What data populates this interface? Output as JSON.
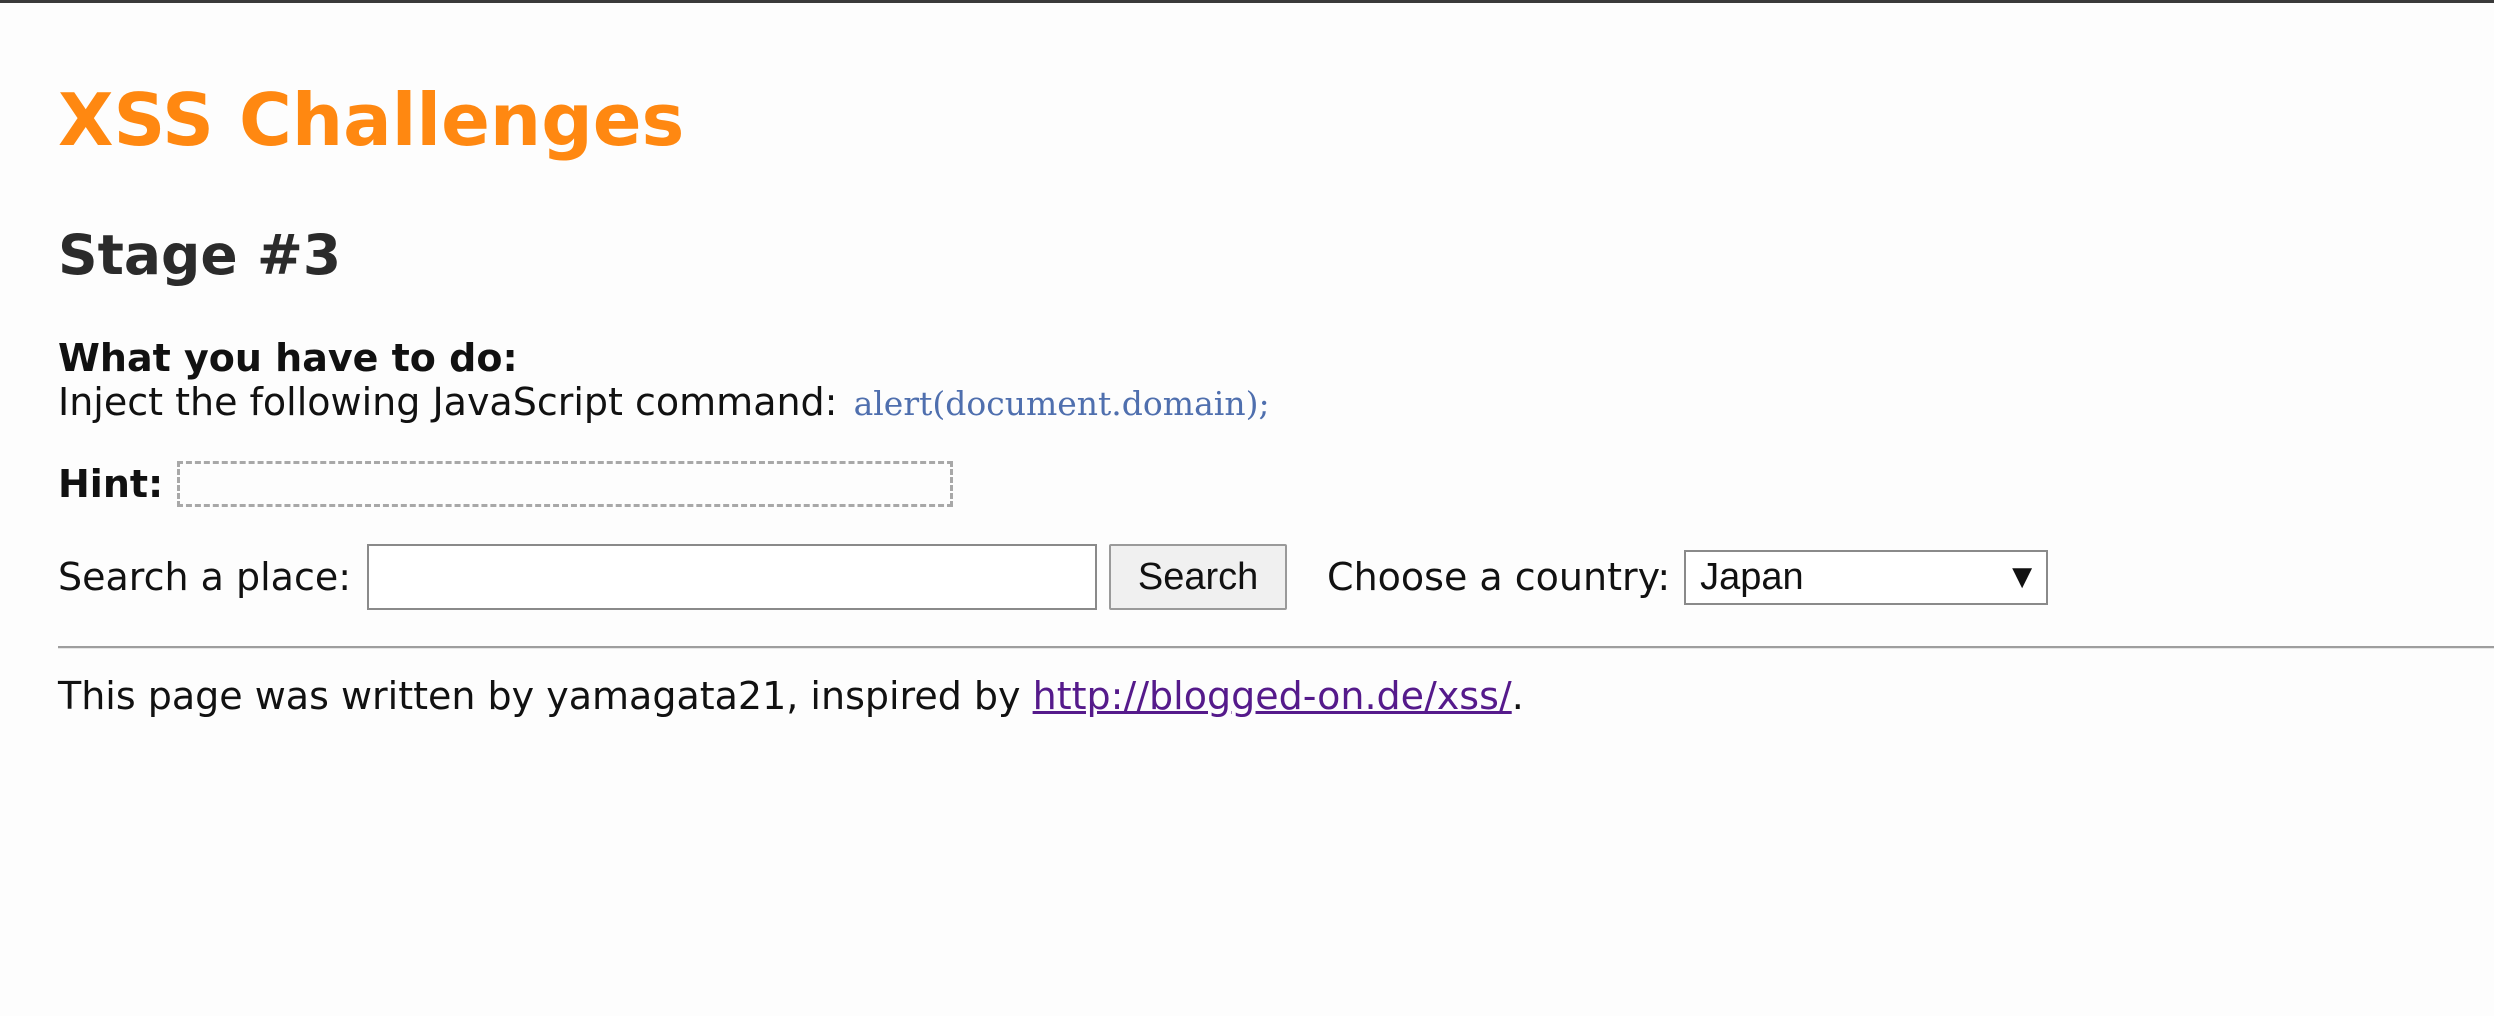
{
  "page": {
    "site_title": "XSS Challenges",
    "stage_title": "Stage #3"
  },
  "task": {
    "heading": "What you have to do:",
    "instruction": "Inject the following JavaScript command:",
    "command": "alert(document.domain);"
  },
  "hint": {
    "label": "Hint:",
    "content": ""
  },
  "search": {
    "label": "Search a place:",
    "value": "",
    "button_label": "Search"
  },
  "country": {
    "label": "Choose a country:",
    "selected": "Japan"
  },
  "footer": {
    "text_before": "This page was written by yamagata21, inspired by ",
    "link_text": "http://blogged-on.de/xss/",
    "text_after": "."
  },
  "colors": {
    "title": "#ff8811",
    "code": "#4f6fae",
    "visited_link": "#551a8b"
  }
}
